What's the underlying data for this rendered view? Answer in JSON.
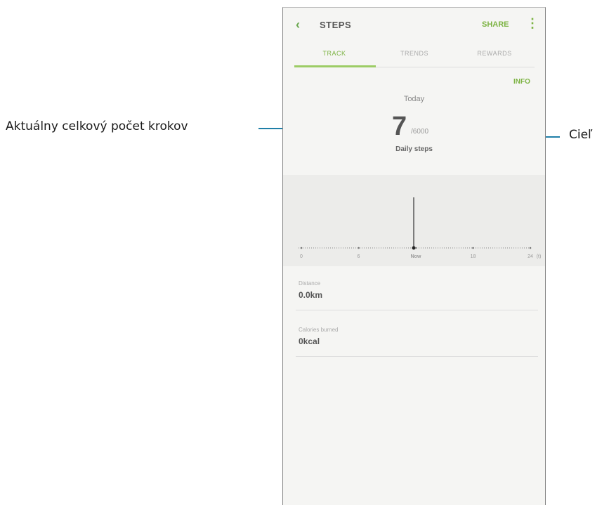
{
  "callouts": {
    "left": "Aktuálny celkový počet krokov",
    "right": "Cieľ"
  },
  "app": {
    "title": "STEPS",
    "share_label": "SHARE",
    "tabs": [
      {
        "label": "TRACK",
        "active": true
      },
      {
        "label": "TRENDS",
        "active": false
      },
      {
        "label": "REWARDS",
        "active": false
      }
    ],
    "info_label": "INFO",
    "today_label": "Today",
    "steps_count": "7",
    "steps_goal": "/6000",
    "daily_label": "Daily steps",
    "timeline": {
      "labels": [
        "0",
        "6",
        "Now",
        "18",
        "24"
      ],
      "unit": "(t)",
      "current_position": "Now"
    },
    "metrics": [
      {
        "label": "Distance",
        "value": "0.0km"
      },
      {
        "label": "Calories burned",
        "value": "0kcal"
      }
    ]
  },
  "colors": {
    "accent": "#7cb342",
    "leader": "#1f7fa8",
    "chart_background": "#ececea"
  }
}
